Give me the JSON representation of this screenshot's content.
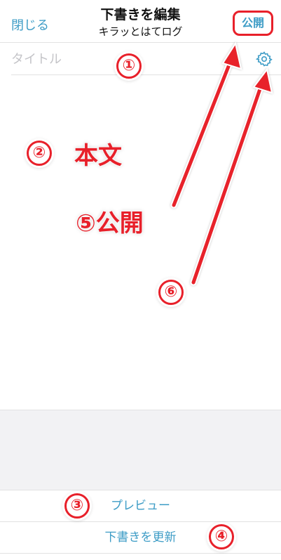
{
  "nav": {
    "close_label": "閉じる",
    "title": "下書きを編集",
    "subtitle": "キラッとはてログ",
    "publish_label": "公開"
  },
  "editor": {
    "title_placeholder": "タイトル"
  },
  "buttons": {
    "preview_label": "プレビュー",
    "update_label": "下書きを更新"
  },
  "annotations": {
    "n1": "①",
    "n2": "②",
    "n3": "③",
    "n4": "④",
    "n6": "⑥",
    "body_label": "本文",
    "publish_label": "⑤公開"
  },
  "colors": {
    "accent": "#3d9cc6",
    "annotation_red": "#e8202a",
    "placeholder": "#c4c4c8",
    "gray_bg": "#f2f2f4"
  }
}
